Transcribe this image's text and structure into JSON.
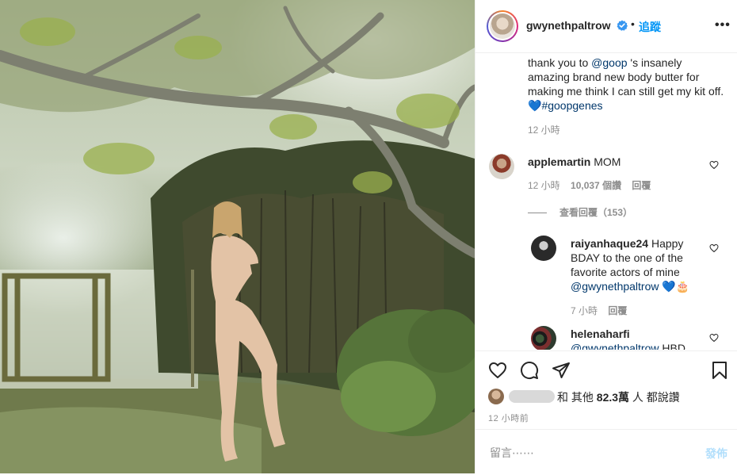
{
  "header": {
    "username": "gwynethpaltrow",
    "separator": "•",
    "follow_label": "追蹤",
    "more_label": "•••"
  },
  "caption": {
    "text_1": "thank you to ",
    "mention": "@goop",
    "text_2": " 's insanely amazing brand new body butter for making me think I can still get my kit off. ",
    "heart": "💙",
    "hashtag": "#goopgenes",
    "time": "12 小時"
  },
  "comments": [
    {
      "username": "applemartin",
      "text": " MOM",
      "time": "12 小時",
      "likes": "10,037 個讚",
      "reply_label": "回覆"
    }
  ],
  "view_replies": "查看回覆（153）",
  "replies": [
    {
      "username": "raiyanhaque24",
      "text": " Happy BDAY to the one of the favorite actors of mine ",
      "mention": "@gwynethpaltrow",
      "emoji": " 💙🎂",
      "time": "7 小時",
      "reply_label": "回覆"
    },
    {
      "username": "helenaharfi",
      "mention": "@gwynethpaltrow",
      "text": " HBD"
    }
  ],
  "likes": {
    "and_label": "和 其他 ",
    "count": "82.3萬",
    "suffix": " 人 都說讚"
  },
  "post_time": "12 小時前",
  "composer": {
    "placeholder": "留言⋯⋯",
    "post_label": "發佈"
  },
  "colors": {
    "accent": "#0095f6",
    "link": "#00376b",
    "secondary_text": "#8e8e8e",
    "post_disabled": "#b2dffc"
  },
  "icons": [
    "verified-badge-icon",
    "heart-icon",
    "comment-icon",
    "share-icon",
    "bookmark-icon",
    "more-icon"
  ]
}
